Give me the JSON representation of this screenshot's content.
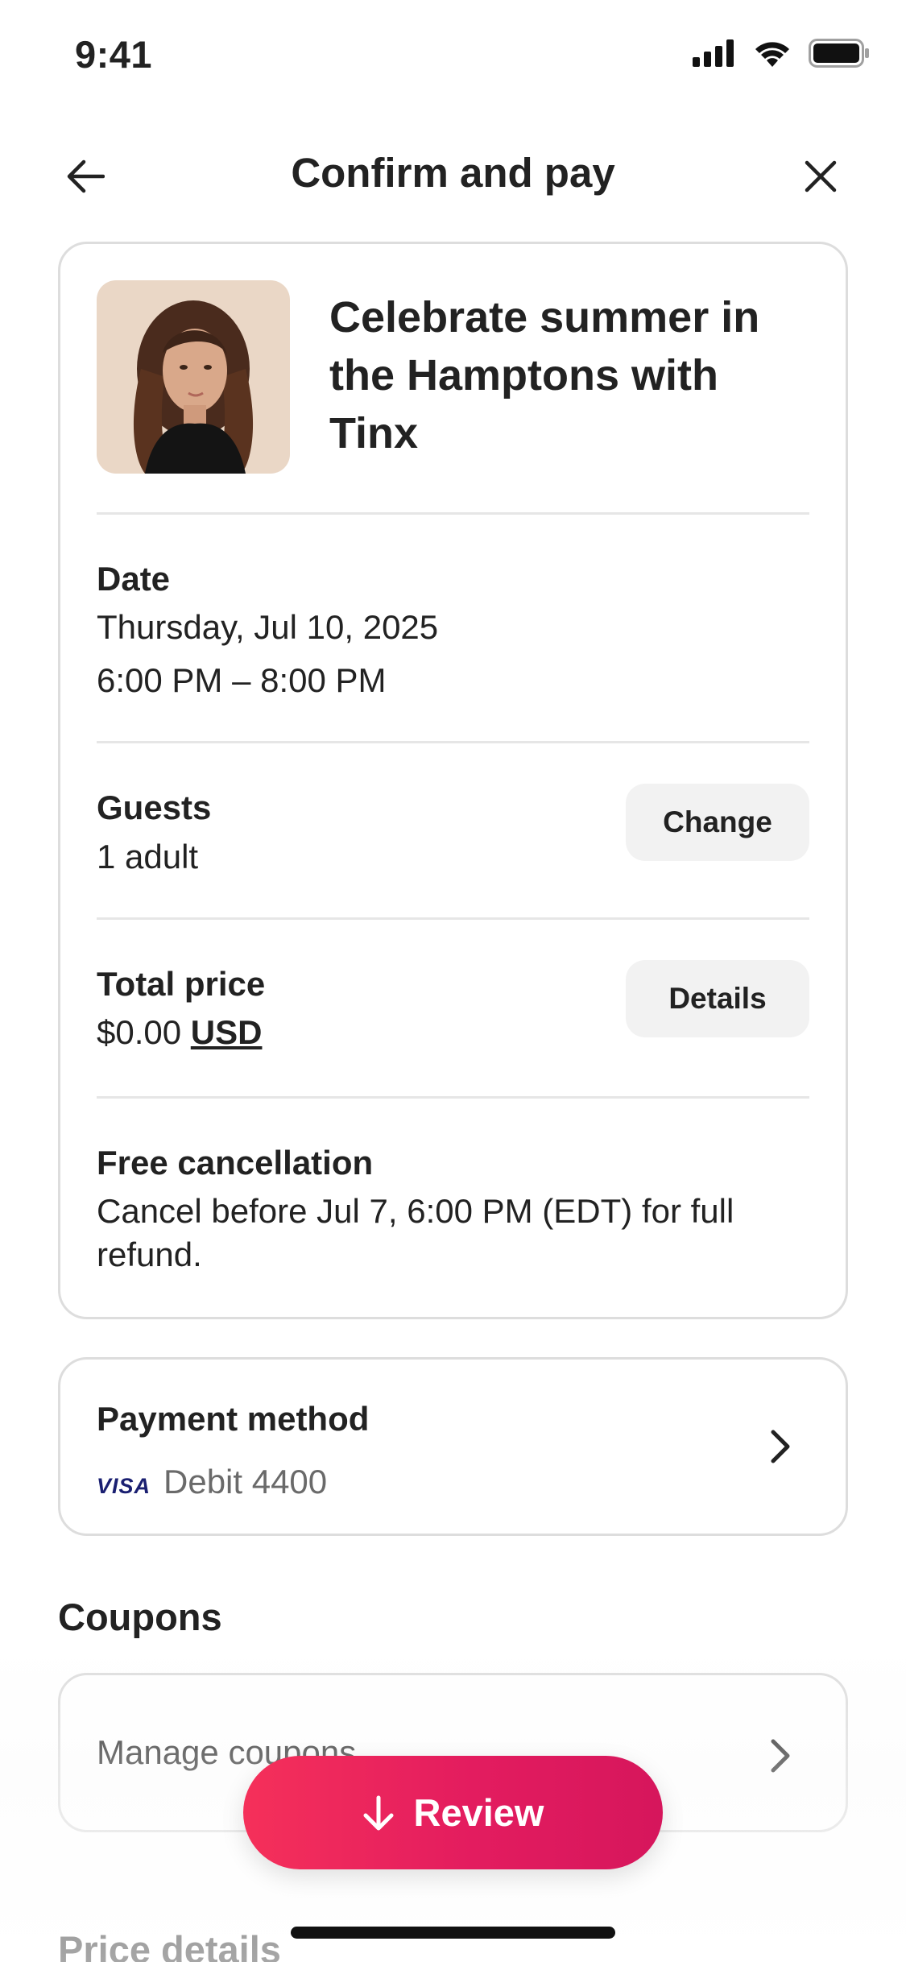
{
  "status_bar": {
    "time": "9:41"
  },
  "header": {
    "title": "Confirm and pay"
  },
  "experience": {
    "title": "Celebrate summer in the Hamptons with Tinx"
  },
  "date": {
    "label": "Date",
    "day": "Thursday, Jul 10, 2025",
    "time_range": "6:00 PM – 8:00 PM"
  },
  "guests": {
    "label": "Guests",
    "value": "1 adult",
    "change_label": "Change"
  },
  "total_price": {
    "label": "Total price",
    "amount": "$0.00",
    "currency": "USD",
    "details_label": "Details"
  },
  "cancellation": {
    "label": "Free cancellation",
    "text": "Cancel before Jul 7, 6:00 PM (EDT) for full refund."
  },
  "payment": {
    "label": "Payment method",
    "brand": "VISA",
    "card": "Debit 4400"
  },
  "coupons": {
    "heading": "Coupons",
    "manage_label": "Manage coupons"
  },
  "price_details": {
    "heading": "Price details"
  },
  "review": {
    "label": "Review"
  },
  "colors": {
    "accent": "#e31c5f",
    "text": "#222222",
    "muted": "#6a6a6a",
    "border": "#dddddd",
    "visa": "#1a1f71"
  }
}
